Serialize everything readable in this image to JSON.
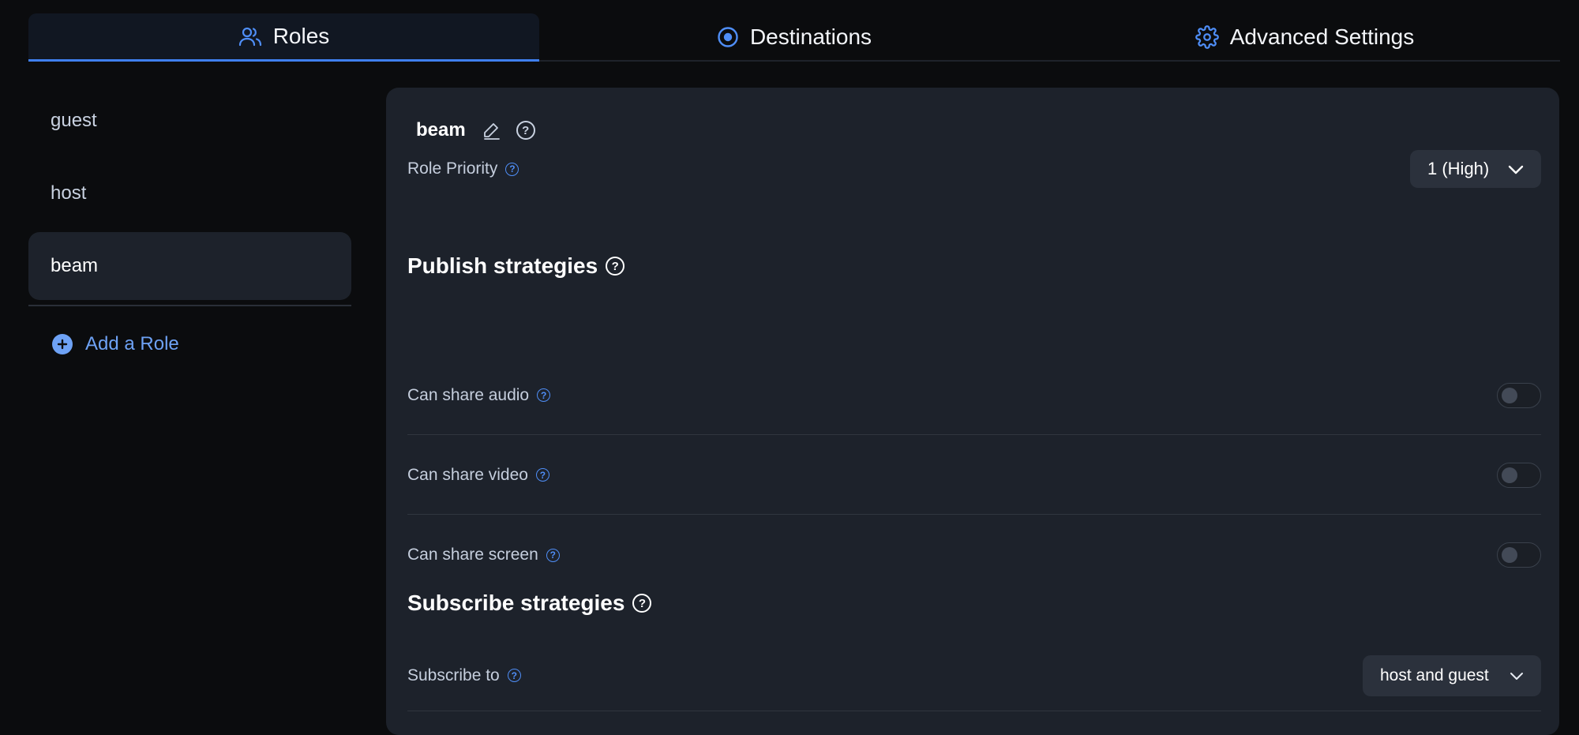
{
  "tabs": [
    {
      "label": "Roles",
      "icon": "users-icon"
    },
    {
      "label": "Destinations",
      "icon": "target-icon"
    },
    {
      "label": "Advanced Settings",
      "icon": "gear-icon"
    }
  ],
  "sidebar": {
    "items": [
      {
        "label": "guest"
      },
      {
        "label": "host"
      },
      {
        "label": "beam"
      }
    ],
    "add_label": "Add a Role"
  },
  "role": {
    "name": "beam",
    "priority_label": "Role Priority",
    "priority_value": "1 (High)"
  },
  "publish": {
    "title": "Publish strategies",
    "rows": [
      {
        "label": "Can share audio",
        "enabled": false
      },
      {
        "label": "Can share video",
        "enabled": false
      },
      {
        "label": "Can share screen",
        "enabled": false
      }
    ]
  },
  "subscribe": {
    "title": "Subscribe strategies",
    "label": "Subscribe to",
    "value": "host and guest"
  },
  "colors": {
    "accent": "#3f7ff0",
    "link": "#6ea2f5",
    "panel": "#1d222b",
    "background": "#0b0c0e"
  }
}
